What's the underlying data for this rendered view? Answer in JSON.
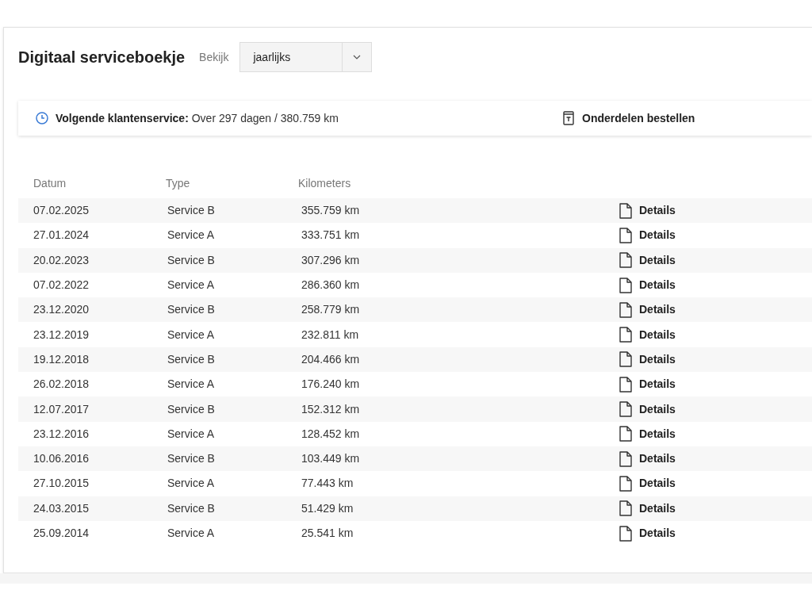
{
  "header": {
    "title": "Digitaal serviceboekje",
    "view_label": "Bekijk",
    "view_select": {
      "value": "jaarlijks"
    }
  },
  "next_service": {
    "label": "Volgende klantenservice:",
    "value": "Over 297 dagen / 380.759 km",
    "order_button": "Onderdelen bestellen"
  },
  "table": {
    "columns": [
      "Datum",
      "Type",
      "Kilometers"
    ],
    "rows": [
      {
        "date": "07.02.2025",
        "type": "Service B",
        "km": "355.759 km",
        "action": "Details"
      },
      {
        "date": "27.01.2024",
        "type": "Service A",
        "km": "333.751 km",
        "action": "Details"
      },
      {
        "date": "20.02.2023",
        "type": "Service B",
        "km": "307.296 km",
        "action": "Details"
      },
      {
        "date": "07.02.2022",
        "type": "Service A",
        "km": "286.360 km",
        "action": "Details"
      },
      {
        "date": "23.12.2020",
        "type": "Service B",
        "km": "258.779 km",
        "action": "Details"
      },
      {
        "date": "23.12.2019",
        "type": "Service A",
        "km": "232.811 km",
        "action": "Details"
      },
      {
        "date": "19.12.2018",
        "type": "Service B",
        "km": "204.466 km",
        "action": "Details"
      },
      {
        "date": "26.02.2018",
        "type": "Service A",
        "km": "176.240 km",
        "action": "Details"
      },
      {
        "date": "12.07.2017",
        "type": "Service B",
        "km": "152.312 km",
        "action": "Details"
      },
      {
        "date": "23.12.2016",
        "type": "Service A",
        "km": "128.452 km",
        "action": "Details"
      },
      {
        "date": "10.06.2016",
        "type": "Service B",
        "km": "103.449 km",
        "action": "Details"
      },
      {
        "date": "27.10.2015",
        "type": "Service A",
        "km": "77.443 km",
        "action": "Details"
      },
      {
        "date": "24.03.2015",
        "type": "Service B",
        "km": "51.429 km",
        "action": "Details"
      },
      {
        "date": "25.09.2014",
        "type": "Service A",
        "km": "25.541 km",
        "action": "Details"
      }
    ]
  }
}
